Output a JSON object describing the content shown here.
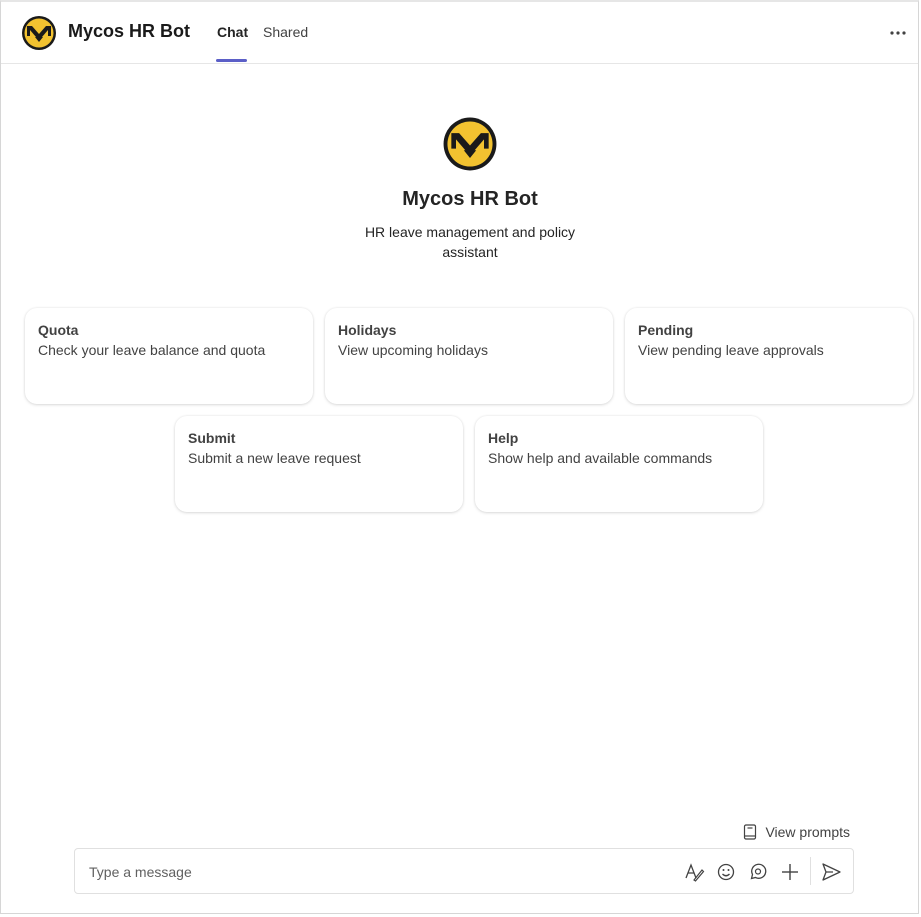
{
  "header": {
    "app_title": "Mycos HR Bot",
    "tabs": [
      {
        "label": "Chat",
        "active": true
      },
      {
        "label": "Shared",
        "active": false
      }
    ],
    "more_icon": "more-horizontal-icon"
  },
  "hero": {
    "title": "Mycos HR Bot",
    "description": "HR leave management and policy assistant"
  },
  "cards": [
    {
      "title": "Quota",
      "description": "Check your leave balance and quota"
    },
    {
      "title": "Holidays",
      "description": "View upcoming holidays"
    },
    {
      "title": "Pending",
      "description": "View pending leave approvals"
    },
    {
      "title": "Submit",
      "description": "Submit a new leave request"
    },
    {
      "title": "Help",
      "description": "Show help and available commands"
    }
  ],
  "composer": {
    "view_prompts_label": "View prompts",
    "placeholder": "Type a message"
  },
  "colors": {
    "accent": "#5b5fc7",
    "logo_yellow": "#f2c230",
    "logo_black": "#1a1a1a"
  }
}
